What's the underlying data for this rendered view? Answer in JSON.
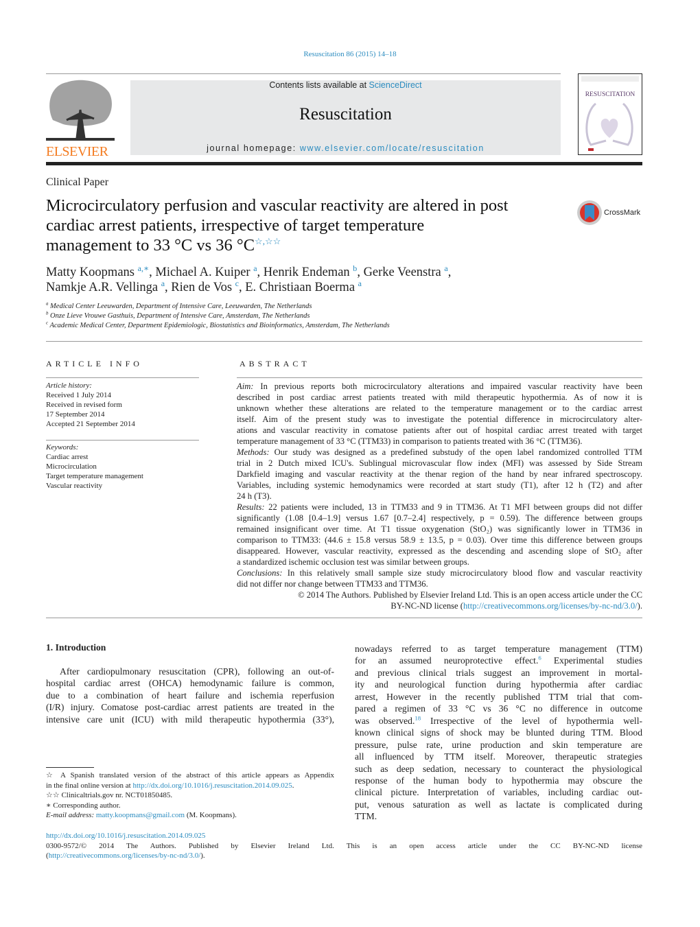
{
  "journal_ref": "Resuscitation 86 (2015) 14–18",
  "masthead": {
    "contents_prefix": "Contents lists available at ",
    "sciencedirect": "ScienceDirect",
    "journal_title": "Resuscitation",
    "homepage_prefix": "journal homepage: ",
    "homepage_url": "www.elsevier.com/locate/resuscitation",
    "publisher_logo": "ELSEVIER",
    "cover_title": "RESUSCITATION"
  },
  "colors": {
    "link": "#2a8bbf",
    "elsevier_orange": "#f47b20",
    "masthead_gray": "#e7e8e9"
  },
  "article": {
    "type": "Clinical Paper",
    "title_lines": [
      "Microcirculatory perfusion and vascular reactivity are altered in post",
      "cardiac arrest patients, irrespective of target temperature",
      "management to 33 °C vs 36 °C"
    ],
    "title_marks": "☆,☆☆",
    "crossmark": "CrossMark",
    "authors": [
      [
        {
          "t": "Matty Koopmans "
        },
        {
          "t": "a,",
          "sup": 1,
          "link": 1
        },
        {
          "t": "∗",
          "sup": 1,
          "link": 1
        },
        {
          "t": ", Michael A. Kuiper "
        },
        {
          "t": "a",
          "sup": 1,
          "link": 1
        },
        {
          "t": ", Henrik Endeman "
        },
        {
          "t": "b",
          "sup": 1,
          "link": 1
        },
        {
          "t": ", Gerke Veenstra "
        },
        {
          "t": "a",
          "sup": 1,
          "link": 1
        },
        {
          "t": ","
        }
      ],
      [
        {
          "t": "Namkje A.R. Vellinga "
        },
        {
          "t": "a",
          "sup": 1,
          "link": 1
        },
        {
          "t": ", Rien de Vos "
        },
        {
          "t": "c",
          "sup": 1,
          "link": 1
        },
        {
          "t": ", E. Christiaan Boerma "
        },
        {
          "t": "a",
          "sup": 1,
          "link": 1
        }
      ]
    ],
    "affiliations": [
      [
        {
          "t": "a",
          "sup": 1
        },
        {
          "t": " Medical Center Leeuwarden, Department of Intensive Care, Leeuwarden, The Netherlands"
        }
      ],
      [
        {
          "t": "b",
          "sup": 1
        },
        {
          "t": " Onze Lieve Vrouwe Gasthuis, Department of Intensive Care, Amsterdam, The Netherlands"
        }
      ],
      [
        {
          "t": "c",
          "sup": 1
        },
        {
          "t": " Academic Medical Center, Department Epidemiologic, Biostatistics and Bioinformatics, Amsterdam, The Netherlands"
        }
      ]
    ]
  },
  "article_info": {
    "heading": "ARTICLE INFO",
    "history": [
      "Article history:",
      "Received 1 July 2014",
      "Received in revised form",
      "17 September 2014",
      "Accepted 21 September 2014"
    ],
    "keywords": [
      "Keywords:",
      "Cardiac arrest",
      "Microcirculation",
      "Target temperature management",
      "Vascular reactivity"
    ]
  },
  "abstract": {
    "heading": "ABSTRACT",
    "lines": [
      [
        {
          "t": "Aim:",
          "i": 1
        },
        {
          "t": " In previous reports both microcirculatory alterations and impaired vascular reactivity have been"
        }
      ],
      "described in post cardiac arrest patients treated with mild therapeutic hypothermia. As of now it is",
      "unknown whether these alterations are related to the temperature management or to the cardiac arrest",
      "itself. Aim of the present study was to investigate the potential difference in microcirculatory alter-",
      "ations and vascular reactivity in comatose patients after out of hospital cardiac arrest treated with target",
      {
        "last": 1,
        "s": "temperature management of 33 °C (TTM33) in comparison to patients treated with 36 °C (TTM36)."
      },
      [
        {
          "t": "Methods:",
          "i": 1
        },
        {
          "t": " Our study was designed as a predefined substudy of the open label randomized controlled TTM"
        }
      ],
      "trial in 2 Dutch mixed ICU's. Sublingual microvascular flow index (MFI) was assessed by Side Stream",
      "Darkfield imaging and vascular reactivity at the thenar region of the hand by near infrared spectroscopy.",
      "Variables, including systemic hemodynamics were recorded at start study (T1), after 12 h (T2) and after",
      {
        "last": 1,
        "s": "24 h (T3)."
      },
      [
        {
          "t": "Results:",
          "i": 1
        },
        {
          "t": " 22 patients were included, 13 in TTM33 and 9 in TTM36. At T1 MFI between groups did not differ"
        }
      ],
      "significantly (1.08 [0.4–1.9] versus 1.67 [0.7–2.4] respectively, p = 0.59). The difference between groups",
      "remained insignificant over time. At T1 tissue oxygenation (StO₂) was significantly lower in TTM36 in",
      "comparison to TTM33: (44.6 ± 15.8 versus 58.9 ± 13.5, p = 0.03). Over time this difference between groups",
      "disappeared. However, vascular reactivity, expressed as the descending and ascending slope of StO₂ after",
      {
        "last": 1,
        "s": "a standardized ischemic occlusion test was similar between groups."
      },
      [
        {
          "t": "Conclusions:",
          "i": 1
        },
        {
          "t": " In this relatively small sample size study microcirculatory blood flow and vascular reactivity"
        }
      ],
      {
        "last": 1,
        "s": "did not differ nor change between TTM33 and TTM36."
      },
      {
        "right": 1,
        "s": "© 2014 The Authors. Published by Elsevier Ireland Ltd. This is an open access article under the CC"
      },
      {
        "right": 1,
        "seg": [
          {
            "t": "BY-NC-ND license ("
          },
          {
            "t": "http://creativecommons.org/licenses/by-nc-nd/3.0/",
            "link": 1
          },
          {
            "t": ")."
          }
        ]
      }
    ]
  },
  "introduction": {
    "heading": "1.  Introduction",
    "col1": [
      "After cardiopulmonary resuscitation (CPR), following an out-of-",
      "hospital cardiac arrest (OHCA) hemodynamic failure is common,",
      "due to a combination of heart failure and ischemia reperfusion",
      "(I/R) injury. Comatose post-cardiac arrest patients are treated in the",
      "intensive care unit (ICU) with mild therapeutic hypothermia (33°),"
    ],
    "col2": [
      "nowadays referred to as target temperature management (TTM)",
      [
        {
          "t": "for an assumed neuroprotective effect."
        },
        {
          "t": "6",
          "sup": 1,
          "link": 1
        },
        {
          "t": " Experimental studies"
        }
      ],
      "and previous clinical trials suggest an improvement in mortal-",
      "ity and neurological function during hypothermia after cardiac",
      "arrest, However in the recently published TTM trial that com-",
      "pared a regimen of 33 °C vs 36 °C no difference in outcome",
      [
        {
          "t": "was observed."
        },
        {
          "t": "18",
          "sup": 1,
          "link": 1
        },
        {
          "t": " Irrespective of the level of hypothermia well-"
        }
      ],
      "known clinical signs of shock may be blunted during TTM. Blood",
      "pressure, pulse rate, urine production and skin temperature are",
      "all influenced by TTM itself. Moreover, therapeutic strategies",
      "such as deep sedation, necessary to counteract the physiological",
      "response of the human body to hypothermia may obscure the",
      "clinical picture. Interpretation of variables, including cardiac out-",
      "put, venous saturation as well as lactate is complicated during",
      {
        "last": 1,
        "s": "TTM."
      }
    ]
  },
  "footnotes": [
    {
      "j": 1,
      "seg": [
        {
          "t": "  ☆ ",
          "sup": 0
        },
        {
          "t": "A Spanish translated version of the abstract of this article appears as Appendix"
        }
      ]
    },
    {
      "seg": [
        {
          "t": "in the final online version at "
        },
        {
          "t": "http://dx.doi.org/10.1016/j.resuscitation.2014.09.025",
          "link": 1
        },
        {
          "t": "."
        }
      ]
    },
    {
      "seg": [
        {
          "t": "   ☆☆ Clinicaltrials.gov nr. NCT01850485."
        }
      ]
    },
    {
      "seg": [
        {
          "t": "    ∗  Corresponding author."
        }
      ]
    },
    {
      "seg": [
        {
          "t": "      "
        },
        {
          "t": "E-mail address:",
          "i": 1
        },
        {
          "t": " "
        },
        {
          "t": "matty.koopmans@gmail.com",
          "link": 1
        },
        {
          "t": " (M. Koopmans)."
        }
      ]
    }
  ],
  "bottom": [
    {
      "seg": [
        {
          "t": "http://dx.doi.org/10.1016/j.resuscitation.2014.09.025",
          "link": 1
        }
      ]
    },
    {
      "j": 1,
      "seg": [
        {
          "t": "0300-9572/© 2014 The Authors. Published by Elsevier Ireland Ltd. This is an open access article under the CC BY-NC-ND license"
        }
      ]
    },
    {
      "seg": [
        {
          "t": "("
        },
        {
          "t": "http://creativecommons.org/licenses/by-nc-nd/3.0/",
          "link": 1
        },
        {
          "t": ")."
        }
      ]
    }
  ]
}
